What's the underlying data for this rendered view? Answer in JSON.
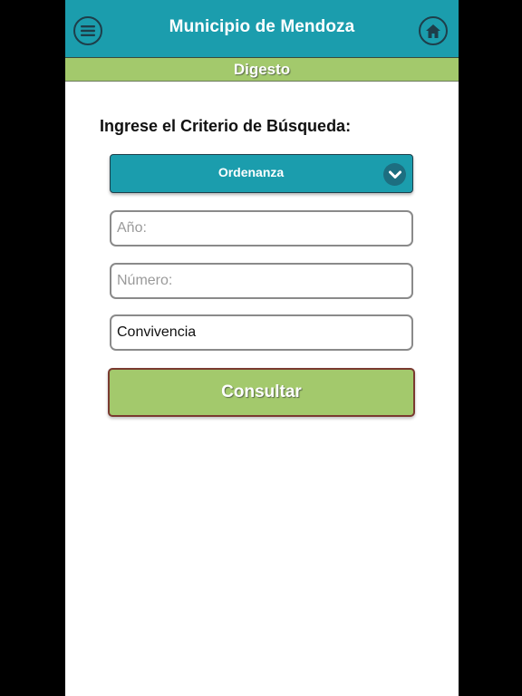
{
  "header": {
    "title": "Municipio de Mendoza",
    "menu_icon": "hamburger-menu-icon",
    "home_icon": "home-icon"
  },
  "subheader": {
    "title": "Digesto"
  },
  "search": {
    "label": "Ingrese el Criterio de Búsqueda:",
    "type_select": {
      "selected": "Ordenanza",
      "icon": "chevron-down-icon"
    },
    "year_field": {
      "value": "",
      "placeholder": "Año:"
    },
    "number_field": {
      "value": "",
      "placeholder": "Número:"
    },
    "text_field": {
      "value": "Convivencia",
      "placeholder": ""
    },
    "submit_label": "Consultar"
  },
  "colors": {
    "primary": "#1b9dad",
    "accent": "#a3c96c",
    "background": "#ffffff",
    "frame": "#000000"
  }
}
